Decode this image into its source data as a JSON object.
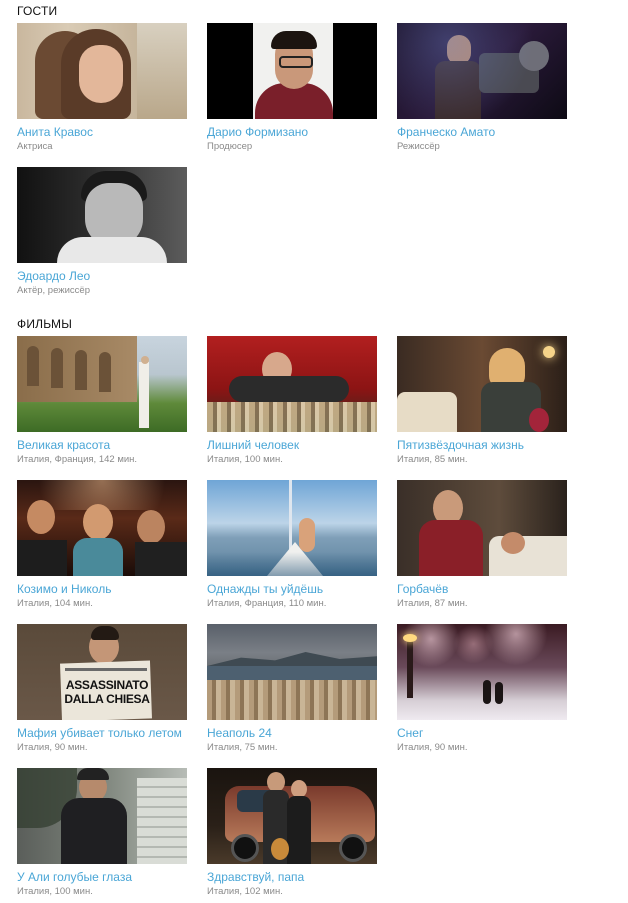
{
  "guests": {
    "heading": "ГОСТИ",
    "items": [
      {
        "name": "Анита Кравос",
        "role": "Актриса"
      },
      {
        "name": "Дарио Формизано",
        "role": "Продюсер"
      },
      {
        "name": "Франческо Амато",
        "role": "Режиссёр"
      },
      {
        "name": "Эдоардо Лео",
        "role": "Актёр, режиссёр"
      }
    ]
  },
  "films": {
    "heading": "ФИЛЬМЫ",
    "items": [
      {
        "title": "Великая красота",
        "info": "Италия, Франция, 142 мин."
      },
      {
        "title": "Лишний человек",
        "info": "Италия, 100 мин."
      },
      {
        "title": "Пятизвёздочная жизнь",
        "info": "Италия, 85 мин."
      },
      {
        "title": "Козимо и Николь",
        "info": "Италия, 104 мин."
      },
      {
        "title": "Однажды ты уйдёшь",
        "info": "Италия, Франция, 110 мин."
      },
      {
        "title": "Горбачёв",
        "info": "Италия, 87 мин."
      },
      {
        "title": "Мафия убивает только летом",
        "info": "Италия, 90 мин."
      },
      {
        "title": "Неаполь 24",
        "info": "Италия, 75 мин."
      },
      {
        "title": "Снег",
        "info": "Италия, 90 мин."
      },
      {
        "title": "У Али голубые глаза",
        "info": "Италия, 100 мин."
      },
      {
        "title": "Здравствуй, папа",
        "info": "Италия, 102 мин."
      }
    ]
  },
  "poster_text": {
    "newspaper_line1": "ASSASSINATO",
    "newspaper_line2": "DALLA CHIESA"
  }
}
